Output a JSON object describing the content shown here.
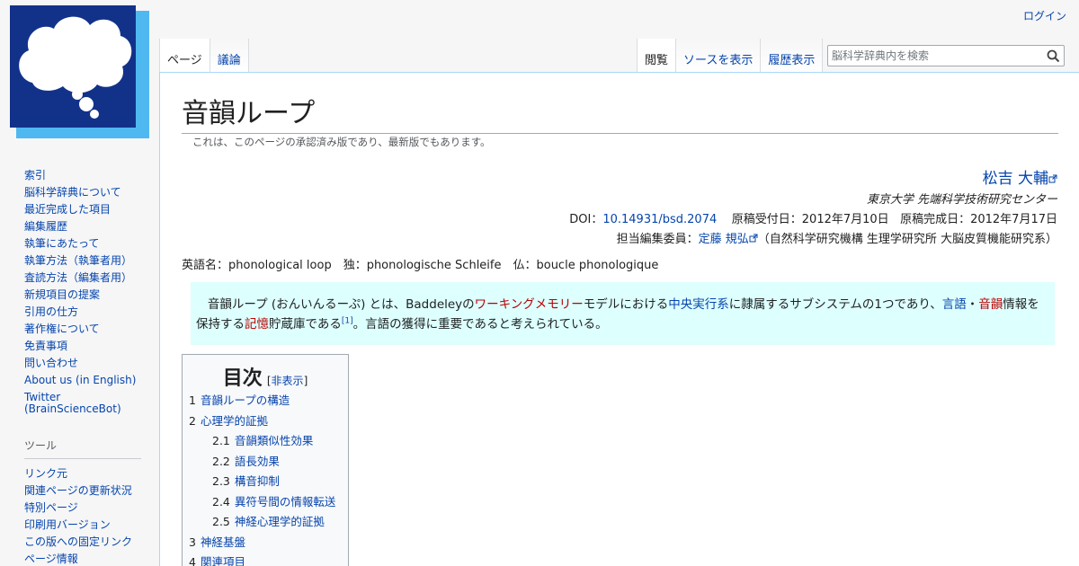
{
  "personal": {
    "login": "ログイン"
  },
  "nav": {
    "tabs_left": [
      {
        "label": "ページ",
        "selected": true
      },
      {
        "label": "議論",
        "selected": false
      }
    ],
    "tabs_right": [
      {
        "label": "閲覧",
        "selected": true
      },
      {
        "label": "ソースを表示",
        "selected": false
      },
      {
        "label": "履歴表示",
        "selected": false
      }
    ],
    "search_placeholder": "脳科学辞典内を検索"
  },
  "sidebar": {
    "items": [
      "索引",
      "脳科学辞典について",
      "最近完成した項目",
      "編集履歴",
      "執筆にあたって",
      "執筆方法（執筆者用）",
      "査読方法（編集者用）",
      "新規項目の提案",
      "引用の仕方",
      "著作権について",
      "免責事項",
      "問い合わせ",
      "About us (in English)"
    ],
    "twitter": "Twitter (BrainScienceBot)",
    "tools_heading": "ツール",
    "tools": [
      "リンク元",
      "関連ページの更新状況",
      "特別ページ",
      "印刷用バージョン",
      "この版への固定リンク",
      "ページ情報"
    ]
  },
  "article": {
    "title": "音韻ループ",
    "approved_note": "これは、このページの承認済み版であり、最新版でもあります。",
    "author": "松吉 大輔",
    "affiliation": "東京大学 先端科学技術研究センター",
    "doi_label": "DOI：",
    "doi": "10.14931/bsd.2074",
    "received": "原稿受付日：2012年7月10日",
    "completed": "原稿完成日：2012年7月17日",
    "editor_label": "担当編集委員：",
    "editor": "定藤 規弘",
    "editor_affil": "（自然科学研究機構 生理学研究所 大脳皮質機能研究系）",
    "english_names": "英語名：phonological loop　独：phonologische Schleife　仏：boucle phonologique",
    "intro": {
      "p1": "音韻ループ (おんいんるーぷ) とは、Baddeleyの",
      "link_wm": "ワーキングメモリー",
      "p2": "モデルにおける",
      "link_ce": "中央実行系",
      "p3": "に隷属するサブシステムの1つであり、",
      "link_lang": "言語",
      "p4": "・",
      "link_phon": "音韻",
      "p5": "情報を保持する",
      "link_mem": "記憶",
      "p6": "貯蔵庫である",
      "ref": "[1]",
      "p7": "。言語の獲得に重要であると考えられている。"
    },
    "toc": {
      "title": "目次",
      "toggle_open": "[",
      "toggle": "非表示",
      "toggle_close": "]",
      "items": [
        {
          "num": "1",
          "label": "音韻ループの構造",
          "sub": false
        },
        {
          "num": "2",
          "label": "心理学的証拠",
          "sub": false
        },
        {
          "num": "2.1",
          "label": "音韻類似性効果",
          "sub": true
        },
        {
          "num": "2.2",
          "label": "語長効果",
          "sub": true
        },
        {
          "num": "2.3",
          "label": "構音抑制",
          "sub": true
        },
        {
          "num": "2.4",
          "label": "異符号間の情報転送",
          "sub": true
        },
        {
          "num": "2.5",
          "label": "神経心理学的証拠",
          "sub": true
        },
        {
          "num": "3",
          "label": "神経基盤",
          "sub": false
        },
        {
          "num": "4",
          "label": "関連項目",
          "sub": false
        }
      ]
    }
  },
  "colors": {
    "link": "#0645ad",
    "redlink": "#ba0000",
    "intro_bg": "#ddfffe",
    "logo_blue": "#1a3c8c"
  }
}
